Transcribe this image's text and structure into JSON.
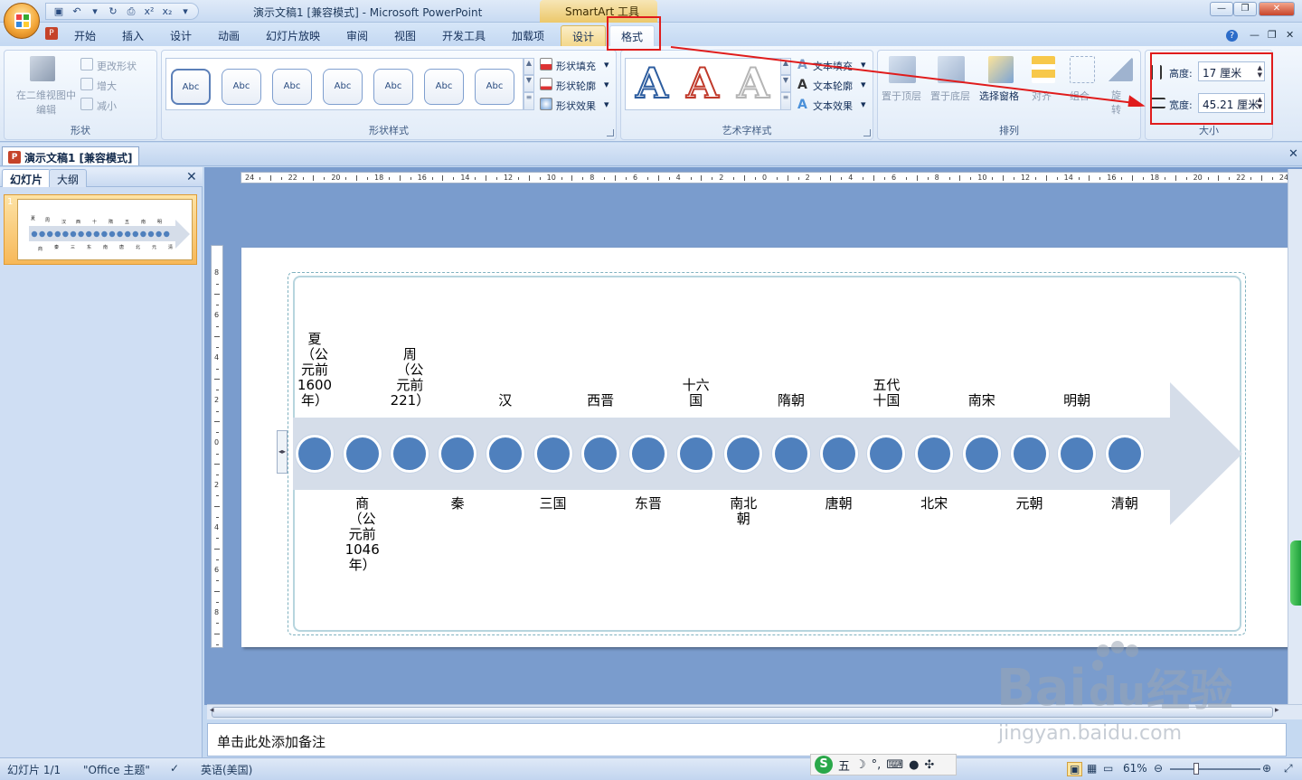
{
  "window": {
    "title": "演示文稿1 [兼容模式] - Microsoft PowerPoint",
    "contextual_tools": "SmartArt 工具",
    "controls": [
      "—",
      "❐",
      "✕"
    ]
  },
  "ribbon_tabs": [
    "开始",
    "插入",
    "设计",
    "动画",
    "幻灯片放映",
    "审阅",
    "视图",
    "开发工具",
    "加载项",
    "设计",
    "格式"
  ],
  "ribbon": {
    "shapes_group": {
      "label": "形状",
      "edit_2d": "在二维视图中\n编辑",
      "change_shape": "更改形状",
      "larger": "增大",
      "smaller": "减小"
    },
    "shape_styles_group": {
      "label": "形状样式",
      "gallery": [
        "Abc",
        "Abc",
        "Abc",
        "Abc",
        "Abc",
        "Abc",
        "Abc"
      ],
      "fill": "形状填充",
      "outline": "形状轮廓",
      "effects": "形状效果"
    },
    "wordart_group": {
      "label": "艺术字样式",
      "samples": [
        "A",
        "A",
        "A"
      ],
      "text_fill": "文本填充",
      "text_outline": "文本轮廓",
      "text_effects": "文本效果"
    },
    "arrange_group": {
      "label": "排列",
      "bring_front": "置于顶层",
      "send_back": "置于底层",
      "selection_pane": "选择窗格",
      "align": "对齐",
      "group": "组合",
      "rotate": "旋转"
    },
    "size_group": {
      "label": "大小",
      "height_label": "高度:",
      "height_value": "17 厘米",
      "width_label": "宽度:",
      "width_value": "45.21 厘米"
    }
  },
  "document_tab": "演示文稿1 [兼容模式]",
  "left_pane": {
    "tab_slides": "幻灯片",
    "tab_outline": "大纲",
    "slide_number": "1"
  },
  "ruler": {
    "horizontal": [
      "24",
      "22",
      "20",
      "18",
      "16",
      "14",
      "12",
      "10",
      "8",
      "6",
      "4",
      "2",
      "0",
      "2",
      "4",
      "6",
      "8",
      "10",
      "12",
      "14",
      "16",
      "18",
      "20",
      "22",
      "24"
    ],
    "vertical": [
      "8",
      "6",
      "4",
      "2",
      "0",
      "2",
      "4",
      "6",
      "8"
    ]
  },
  "smartart": {
    "top_labels": [
      "夏\n（公\n元前\n1600\n年）",
      "周\n（公\n元前\n221）",
      "汉",
      "西晋",
      "十六\n国",
      "隋朝",
      "五代\n十国",
      "南宋",
      "明朝"
    ],
    "bottom_labels": [
      "商\n（公\n元前\n1046\n年）",
      "秦",
      "三国",
      "东晋",
      "南北\n朝",
      "唐朝",
      "北宋",
      "元朝",
      "清朝"
    ],
    "circle_count": 18,
    "arrow_color": "#d5dde9",
    "circle_color": "#4f80bd"
  },
  "notes_placeholder": "单击此处添加备注",
  "status": {
    "slide_info": "幻灯片 1/1",
    "theme": "\"Office 主题\"",
    "language": "英语(美国)",
    "zoom": "61%",
    "ime_mode": "五"
  },
  "watermark": {
    "brand": "Bai",
    "brand2": "du",
    "cn": "经验",
    "url": "jingyan.baidu.com"
  },
  "annotation_color": "#e01c1c"
}
